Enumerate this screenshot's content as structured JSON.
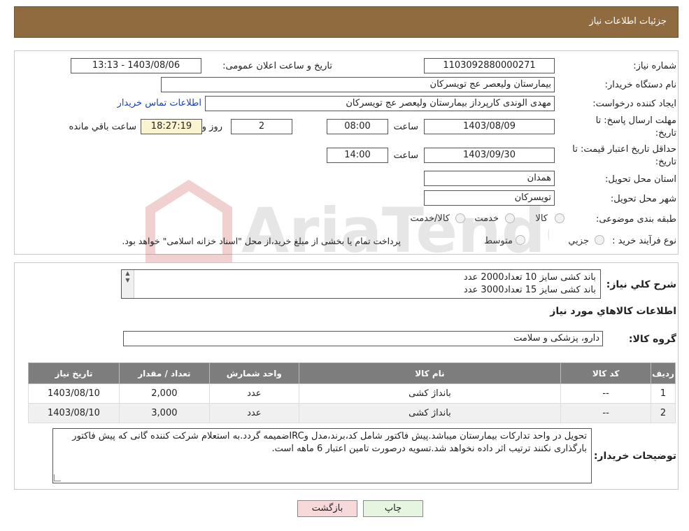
{
  "header": {
    "title": "جزئیات اطلاعات نیاز"
  },
  "form": {
    "need_number_label": "شماره نیاز:",
    "need_number": "1103092880000271",
    "announce_label": "تاریخ و ساعت اعلان عمومی:",
    "announce_value": "1403/08/06 - 13:13",
    "buyer_label": "نام دستگاه خریدار:",
    "buyer_value": "بیمارستان ولیعصر  عج  تویسرکان",
    "creator_label": "ایجاد کننده درخواست:",
    "creator_value": "مهدی الوندی کارپرداز بیمارستان ولیعصر  عج  تویسرکان",
    "contact_link": "اطلاعات تماس خریدار",
    "deadline_label_1": "مهلت ارسال پاسخ: تا",
    "deadline_label_2": "تاریخ:",
    "deadline_date": "1403/08/09",
    "time_label": "ساعت",
    "deadline_time": "08:00",
    "days_value": "2",
    "days_label": "روز و",
    "remaining_value": "18:27:19",
    "remaining_label": "ساعت باقي مانده",
    "validity_label_1": "حداقل تاریخ اعتبار قیمت: تا",
    "validity_label_2": "تاریخ:",
    "validity_date": "1403/09/30",
    "validity_time_label": "ساعت",
    "validity_time": "14:00",
    "province_label": "استان محل تحویل:",
    "province_value": "همدان",
    "city_label": "شهر محل تحویل:",
    "city_value": "تویسرکان",
    "category_label": "طبقه بندی موضوعی:",
    "category_options": [
      "کالا",
      "خدمت",
      "کالا/خدمت"
    ],
    "process_label": "نوع فرآیند خرید :",
    "process_options": [
      "جزيي",
      "متوسط"
    ],
    "process_note": "پرداخت تمام یا بخشی از مبلغ خرید،از محل \"اسناد خزانه اسلامی\" خواهد بود."
  },
  "summary": {
    "label": "شرح کلي نياز:",
    "line1": "باند کشی سایز 10 تعداد2000 عدد",
    "line2": "باند کشی سایز 15 تعداد3000 عدد"
  },
  "goods": {
    "section_title": "اطلاعات کالاهاي مورد نياز",
    "group_label": "گروه کالا:",
    "group_value": "دارو، پزشکی و سلامت",
    "columns": [
      "ردیف",
      "کد کالا",
      "نام کالا",
      "واحد شمارش",
      "تعداد / مقدار",
      "تاریخ نیاز"
    ],
    "rows": [
      {
        "index": "1",
        "code": "--",
        "name": "بانداژ کشی",
        "unit": "عدد",
        "qty": "2,000",
        "date": "1403/08/10"
      },
      {
        "index": "2",
        "code": "--",
        "name": "بانداژ کشی",
        "unit": "عدد",
        "qty": "3,000",
        "date": "1403/08/10"
      }
    ]
  },
  "notes": {
    "label": "توضیحات خریدار:",
    "text": "تحویل در واحد تدارکات بیمارستان میباشد.پیش فاکتور شامل کد،برند،مدل وIRCضمیمه گردد.به استعلام شرکت کننده گانی که پیش فاکتور بارگذاری نکنند ترتیب اثر داده نخواهد شد.تسویه درصورت تامین اعتبار 6 ماهه است."
  },
  "buttons": {
    "print": "چاپ",
    "back": "بازگشت"
  },
  "watermark": {
    "text": "AriaTender.neT"
  },
  "colors": {
    "header": "#8f6b3f",
    "table_header": "#7d7d7d",
    "link": "#1a3fb5",
    "back_button": "#f7d9d9",
    "print_button": "#e6f5e0"
  }
}
